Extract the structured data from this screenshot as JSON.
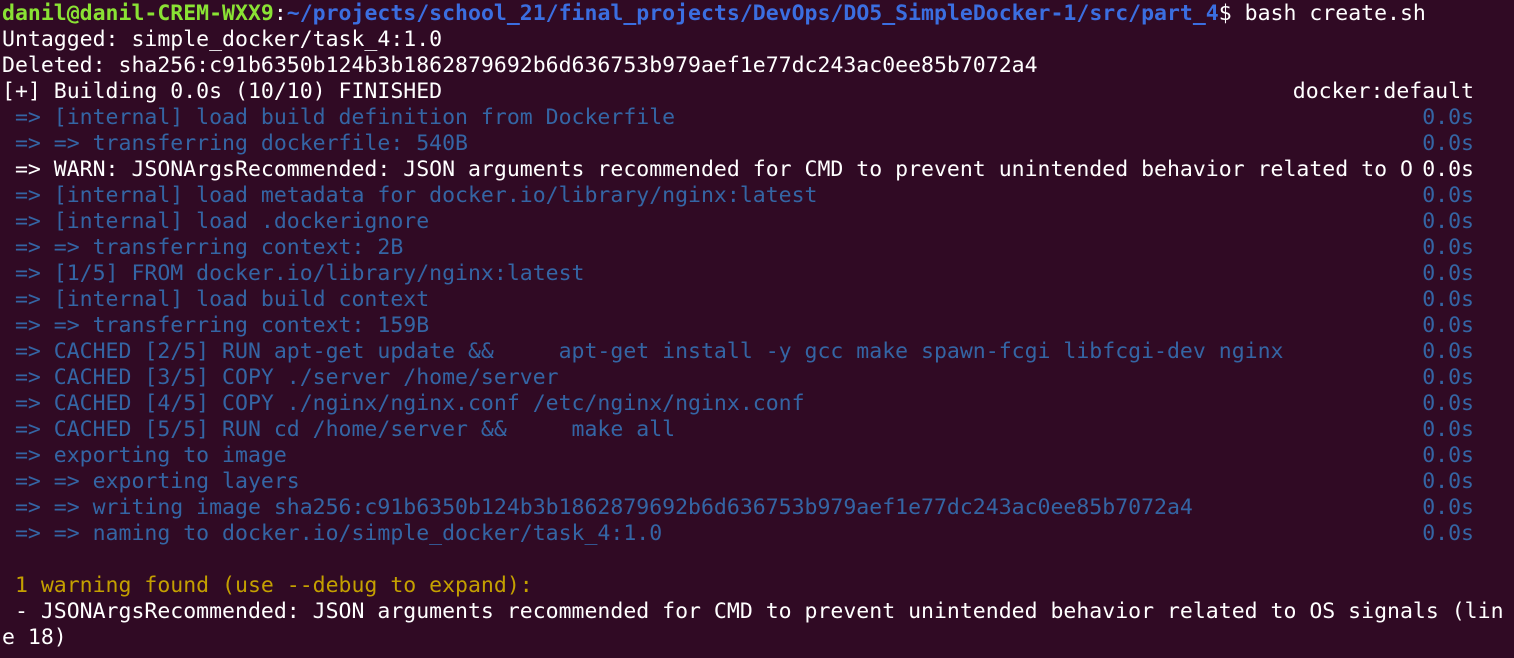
{
  "prompt": {
    "user_host": "danil@danil-CREM-WXX9",
    "sep": ":",
    "path": "~/projects/school_21/final_projects/DevOps/DO5_SimpleDocker-1/src/part_4",
    "symbol": "$ ",
    "command": "bash create.sh"
  },
  "untagged": "Untagged: simple_docker/task_4:1.0",
  "deleted": "Deleted: sha256:c91b6350b124b3b1862879692b6d636753b979aef1e77dc243ac0ee85b7072a4",
  "build_header": {
    "text": "[+] Building 0.0s (10/10) FINISHED",
    "context": "docker:default"
  },
  "steps": [
    {
      "text": " => [internal] load build definition from Dockerfile",
      "time": "0.0s",
      "style": "blue"
    },
    {
      "text": " => => transferring dockerfile: 540B",
      "time": "0.0s",
      "style": "blue"
    },
    {
      "text": " => WARN: JSONArgsRecommended: JSON arguments recommended for CMD to prevent unintended behavior related to O",
      "time": "0.0s",
      "style": "white"
    },
    {
      "text": " => [internal] load metadata for docker.io/library/nginx:latest",
      "time": "0.0s",
      "style": "blue"
    },
    {
      "text": " => [internal] load .dockerignore",
      "time": "0.0s",
      "style": "blue"
    },
    {
      "text": " => => transferring context: 2B",
      "time": "0.0s",
      "style": "blue"
    },
    {
      "text": " => [1/5] FROM docker.io/library/nginx:latest",
      "time": "0.0s",
      "style": "blue"
    },
    {
      "text": " => [internal] load build context",
      "time": "0.0s",
      "style": "blue"
    },
    {
      "text": " => => transferring context: 159B",
      "time": "0.0s",
      "style": "blue"
    },
    {
      "text": " => CACHED [2/5] RUN apt-get update &&     apt-get install -y gcc make spawn-fcgi libfcgi-dev nginx",
      "time": "0.0s",
      "style": "blue"
    },
    {
      "text": " => CACHED [3/5] COPY ./server /home/server",
      "time": "0.0s",
      "style": "blue"
    },
    {
      "text": " => CACHED [4/5] COPY ./nginx/nginx.conf /etc/nginx/nginx.conf",
      "time": "0.0s",
      "style": "blue"
    },
    {
      "text": " => CACHED [5/5] RUN cd /home/server &&     make all",
      "time": "0.0s",
      "style": "blue"
    },
    {
      "text": " => exporting to image",
      "time": "0.0s",
      "style": "blue"
    },
    {
      "text": " => => exporting layers",
      "time": "0.0s",
      "style": "blue"
    },
    {
      "text": " => => writing image sha256:c91b6350b124b3b1862879692b6d636753b979aef1e77dc243ac0ee85b7072a4",
      "time": "0.0s",
      "style": "blue"
    },
    {
      "text": " => => naming to docker.io/simple_docker/task_4:1.0",
      "time": "0.0s",
      "style": "blue"
    }
  ],
  "warning_summary": " 1 warning found (use --debug to expand):",
  "warning_lines": [
    " - JSONArgsRecommended: JSON arguments recommended for CMD to prevent unintended behavior related to OS signals (lin",
    "e 18)"
  ],
  "colors": {
    "background": "#300a24",
    "text": "#ffffff",
    "step_blue": "#3465a4",
    "prompt_green": "#8ae234",
    "prompt_path": "#3b6ee0",
    "warning_yellow": "#c4a000"
  }
}
